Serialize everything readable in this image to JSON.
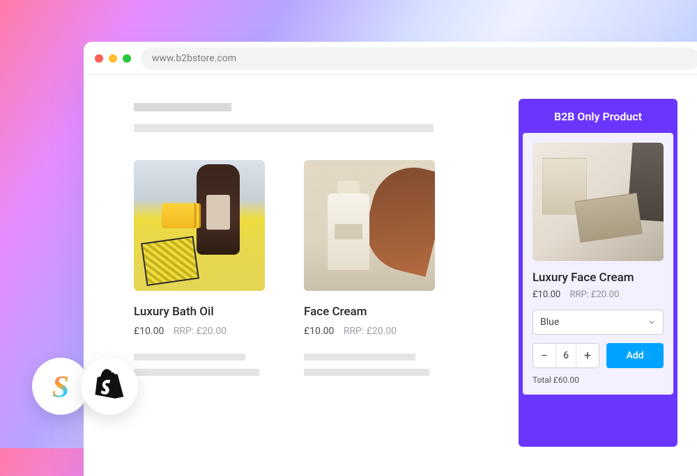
{
  "browser": {
    "url": "www.b2bstore.com"
  },
  "catalog": {
    "products": [
      {
        "title": "Luxury Bath Oil",
        "price": "£10.00",
        "rrp": "RRP: £20.00"
      },
      {
        "title": "Face Cream",
        "price": "£10.00",
        "rrp": "RRP: £20.00"
      }
    ]
  },
  "panel": {
    "header": "B2B Only Product",
    "product_title": "Luxury Face Cream",
    "price": "£10.00",
    "rrp": "RRP: £20.00",
    "variant_selected": "Blue",
    "quantity": "6",
    "add_label": "Add",
    "total_label": "Total £60.00"
  },
  "logos": {
    "sparklayer": "S",
    "shopify": "shopify"
  },
  "colors": {
    "accent_purple": "#6a36ff",
    "accent_blue": "#00a3ff"
  }
}
